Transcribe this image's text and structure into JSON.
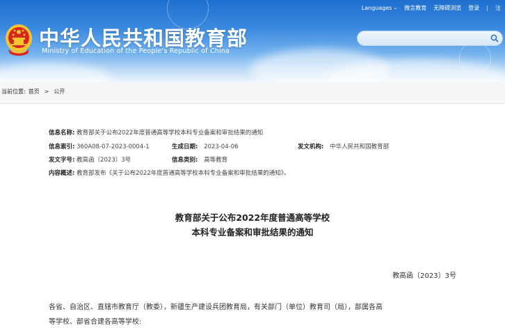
{
  "topbar": {
    "languages": "Languages",
    "weibo": "微言教育",
    "accessibility": "无障碍浏览",
    "login": "登录",
    "separator": "|",
    "more": "注"
  },
  "site": {
    "title": "中华人民共和国教育部",
    "subtitle": "Ministry of Education of the People's Republic of China"
  },
  "search": {
    "placeholder": ""
  },
  "breadcrumb": {
    "current_label": "当前位置:",
    "home": "首页",
    "arrow": ">",
    "section": "公开"
  },
  "meta": {
    "name_label": "信息名称:",
    "name_value": "教育部关于公布2022年度普通高等学校本科专业备案和审批结果的通知",
    "index_label": "信息索引:",
    "index_value": "360A08-07-2023-0004-1",
    "date_label": "生成日期:",
    "date_value": "2023-04-06",
    "issuer_label": "发文机构:",
    "issuer_value": "中华人民共和国教育部",
    "docno_label": "发文字号:",
    "docno_value": "教高函〔2023〕3号",
    "category_label": "信息类别:",
    "category_value": "高等教育",
    "summary_label": "内容概述:",
    "summary_value": "教育部发布《关于公布2022年度普通高等学校本科专业备案和审批结果的通知》。"
  },
  "document": {
    "title_line1": "教育部关于公布2022年度普通高等学校",
    "title_line2": "本科专业备案和审批结果的通知",
    "number": "教高函〔2023〕3号",
    "body_line1": "各省、自治区、直辖市教育厅（教委），新疆生产建设兵团教育局，有关部门（单位）教育司（局），部属各高",
    "body_line2": "等学校、部省合建各高等学校:"
  },
  "colors": {
    "header_blue": "#1f6fcf",
    "emblem_red": "#d7261e",
    "emblem_gold": "#f4c531"
  }
}
